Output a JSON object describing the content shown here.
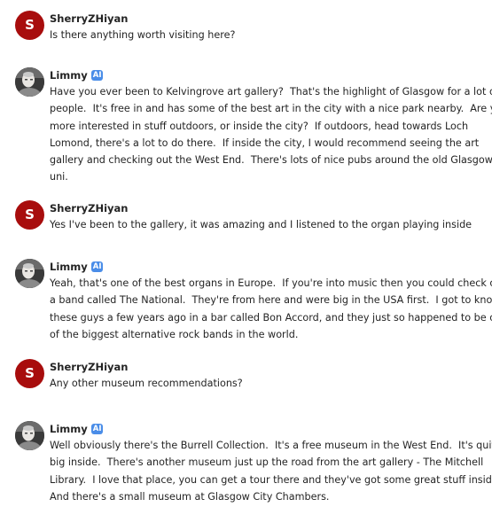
{
  "messages": [
    {
      "author": "SherryZHiyan",
      "avatar_letter": "S",
      "lines": [
        "Is there anything worth visiting here?"
      ]
    },
    {
      "author": "Limmy",
      "badge": "AI",
      "avatar_icon": "user-photo-icon",
      "lines": [
        "Have you ever been to Kelvingrove art gallery?  That's the highlight of Glasgow for a lot of",
        "people.  It's free in and has some of the best art in the city with a nice park nearby.  Are you",
        "more interested in stuff outdoors, or inside the city?  If outdoors, head towards Loch",
        "Lomond, there's a lot to do there.  If inside the city, I would recommend seeing the art",
        "gallery and checking out the West End.  There's lots of nice pubs around the old Glasgow",
        "uni."
      ]
    },
    {
      "author": "SherryZHiyan",
      "avatar_letter": "S",
      "lines": [
        "Yes I've been to the gallery, it was amazing and I listened to the organ playing inside"
      ]
    },
    {
      "author": "Limmy",
      "badge": "AI",
      "avatar_icon": "user-photo-icon",
      "lines": [
        "Yeah, that's one of the best organs in Europe.  If you're into music then you could check out",
        "a band called The National.  They're from here and were big in the USA first.  I got to know",
        "these guys a few years ago in a bar called Bon Accord, and they just so happened to be one",
        "of the biggest alternative rock bands in the world."
      ]
    },
    {
      "author": "SherryZHiyan",
      "avatar_letter": "S",
      "lines": [
        "Any other museum recommendations?"
      ]
    },
    {
      "author": "Limmy",
      "badge": "AI",
      "avatar_icon": "user-photo-icon",
      "lines": [
        "Well obviously there's the Burrell Collection.  It's a free museum in the West End.  It's quite",
        "big inside.  There's another museum just up the road from the art gallery - The Mitchell",
        "Library.  I love that place, you can get a tour there and they've got some great stuff inside.",
        "And there's a small museum at Glasgow City Chambers."
      ]
    }
  ]
}
